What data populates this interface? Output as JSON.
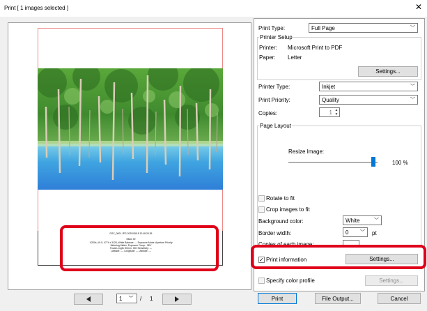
{
  "window": {
    "title": "Print [ 1 images selected ]",
    "close_glyph": "✕"
  },
  "preview": {
    "info_lines": [
      "DSC_0001.JPG  2020/05/18 12:48:26.35",
      "",
      "Nikon Df",
      "1/200s, f/4.5, 4774 x 3128, White Balance: --- Exposure Mode: Aperture Priority",
      "Metering Matrix, Exposure Comp.: 0EV",
      "Focal Length: 50mm, ISO Sensitivity: ---",
      "Latitude: ---, Longitude: ---, Altitude: ---"
    ],
    "prev_icon": "prev-page-icon",
    "next_icon": "next-page-icon",
    "page_current": "1",
    "page_separator": "/",
    "page_total": "1"
  },
  "settings": {
    "print_type_label": "Print Type:",
    "print_type_value": "Full Page",
    "printer_setup_legend": "Printer Setup",
    "printer_label": "Printer:",
    "printer_value": "Microsoft Print to PDF",
    "paper_label": "Paper:",
    "paper_value": "Letter",
    "settings_button": "Settings...",
    "printer_type_label": "Printer Type:",
    "printer_type_value": "Inkjet",
    "print_priority_label": "Print Priority:",
    "print_priority_value": "Quality",
    "copies_label": "Copies:",
    "copies_value": "1",
    "page_layout_legend": "Page Layout",
    "resize_label": "Resize Image:",
    "resize_value": "100 %",
    "resize_fraction": 0.95,
    "rotate_label": "Rotate to fit",
    "crop_label": "Crop images to fit",
    "bg_color_label": "Background color:",
    "bg_color_value": "White",
    "border_width_label": "Border width:",
    "border_width_value": "0",
    "border_width_unit": "pt",
    "copies_each_label": "Copies of each image:",
    "print_info_label": "Print information",
    "print_info_settings": "Settings...",
    "color_profile_label": "Specify color profile",
    "color_profile_settings": "Settings..."
  },
  "footer": {
    "print_button": "Print",
    "file_output_button": "File Output...",
    "cancel_button": "Cancel"
  },
  "colors": {
    "highlight": "#e0001a",
    "accent": "#0078d7"
  }
}
